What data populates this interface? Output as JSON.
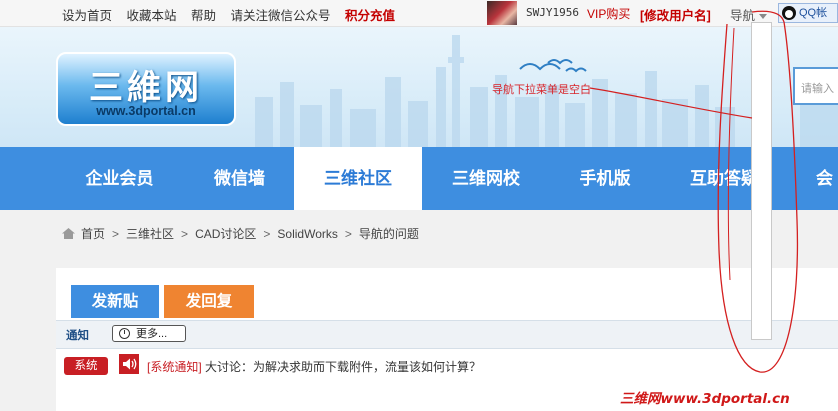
{
  "topbar": {
    "links": [
      "设为首页",
      "收藏本站",
      "帮助",
      "请关注微信公众号",
      "积分充值"
    ],
    "username": "SWJY1956",
    "vip": "VIP购买",
    "rename": "[修改用户名]",
    "nav_dropdown": "导航",
    "qq": "QQ帐"
  },
  "banner": {
    "logo_text": "三維网",
    "logo_url": "www.3dportal.cn",
    "annotation": "导航下拉菜单是空白",
    "search_placeholder": "请输入"
  },
  "nav": {
    "items": [
      "企业会员",
      "微信墙",
      "三维社区",
      "三维网校",
      "手机版",
      "互助答疑",
      "会"
    ],
    "active_index": 2
  },
  "breadcrumb": {
    "items": [
      "首页",
      "三维社区",
      "CAD讨论区",
      "SolidWorks",
      "导航的问题"
    ],
    "separator": ">"
  },
  "actions": {
    "new_post": "发新贴",
    "reply": "发回复"
  },
  "notice": {
    "label": "通知",
    "more": "更多..."
  },
  "row": {
    "badge": "系统",
    "tag": "[系统通知]",
    "text": " 大讨论：为解决求助而下载附件，流量该如何计算？"
  },
  "watermark": "三维网www.3dportal.cn",
  "colors": {
    "nav_blue": "#3e8ee0",
    "accent_red": "#c81f24",
    "orange": "#ef8431"
  }
}
